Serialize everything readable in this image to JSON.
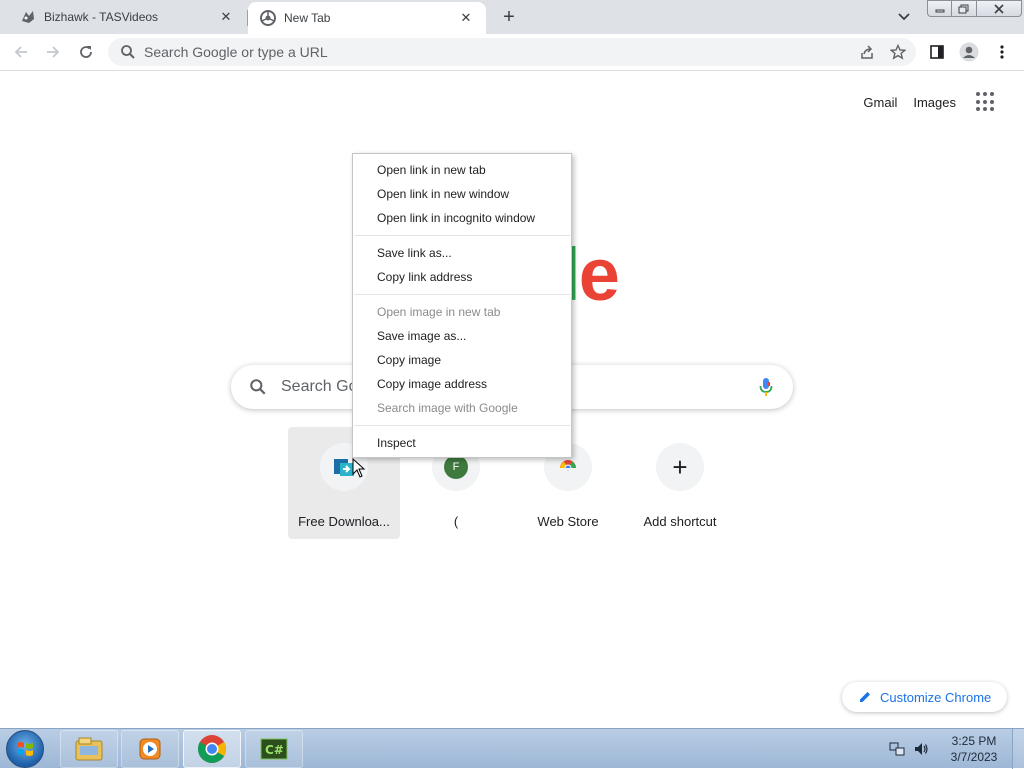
{
  "tabs": [
    {
      "title": "Bizhawk - TASVideos",
      "icon": "bizhawk-favicon"
    },
    {
      "title": "New Tab",
      "icon": "chrome-favicon"
    }
  ],
  "omnibox": {
    "placeholder": "Search Google or type a URL"
  },
  "toplinks": {
    "gmail": "Gmail",
    "images": "Images"
  },
  "logo": {
    "visible_text": "gle",
    "colors": {
      "blue": "#4285f4",
      "red": "#ea4335",
      "yellow": "#fbbc05",
      "green": "#34a853"
    }
  },
  "search": {
    "placeholder": "Search Go"
  },
  "shortcuts": [
    {
      "label": "Free Downloa...",
      "icon": "free-download-icon"
    },
    {
      "label": "(",
      "icon": "letter-avatar",
      "avatar_letter": "F"
    },
    {
      "label": "Web Store",
      "icon": "chrome-web-store-icon"
    },
    {
      "label": "Add shortcut",
      "icon": "plus-icon"
    }
  ],
  "context_menu": {
    "groups": [
      [
        {
          "label": "Open link in new tab",
          "enabled": true
        },
        {
          "label": "Open link in new window",
          "enabled": true
        },
        {
          "label": "Open link in incognito window",
          "enabled": true
        }
      ],
      [
        {
          "label": "Save link as...",
          "enabled": true
        },
        {
          "label": "Copy link address",
          "enabled": true
        }
      ],
      [
        {
          "label": "Open image in new tab",
          "enabled": false
        },
        {
          "label": "Save image as...",
          "enabled": true
        },
        {
          "label": "Copy image",
          "enabled": true
        },
        {
          "label": "Copy image address",
          "enabled": true
        },
        {
          "label": "Search image with Google",
          "enabled": false
        }
      ],
      [
        {
          "label": "Inspect",
          "enabled": true
        }
      ]
    ]
  },
  "customize": {
    "label": "Customize Chrome"
  },
  "taskbar": {
    "apps": [
      "windows-explorer-icon",
      "media-player-icon",
      "chrome-icon",
      "csharp-ide-icon"
    ],
    "clock": {
      "time": "3:25 PM",
      "date": "3/7/2023"
    }
  }
}
